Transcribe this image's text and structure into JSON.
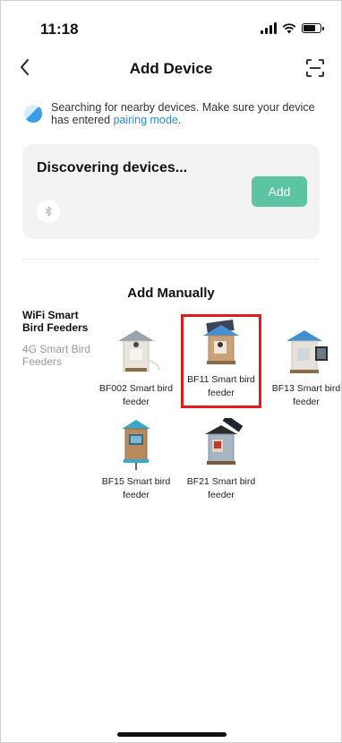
{
  "status_bar": {
    "time": "11:18"
  },
  "nav": {
    "title": "Add Device",
    "back_icon": "chevron-left-icon",
    "scan_icon": "scan-icon"
  },
  "hint": {
    "text": "Searching for nearby devices. Make sure your device has entered ",
    "link": "pairing mode",
    "end": "."
  },
  "discover": {
    "title": "Discovering devices...",
    "add_label": "Add",
    "accent": "#5dc4a3"
  },
  "manual": {
    "title": "Add Manually",
    "categories": [
      {
        "label": "WiFi Smart Bird Feeders",
        "active": true
      },
      {
        "label": "4G Smart Bird Feeders",
        "active": false
      }
    ],
    "products": [
      {
        "label": "BF002 Smart bird feeder"
      },
      {
        "label": "BF11 Smart bird feeder"
      },
      {
        "label": "BF13  Smart bird feeder"
      },
      {
        "label": "BF15 Smart bird feeder"
      },
      {
        "label": "BF21  Smart bird feeder"
      }
    ]
  },
  "colors": {
    "highlight": "#e21b1b",
    "link": "#2f8bd8"
  }
}
